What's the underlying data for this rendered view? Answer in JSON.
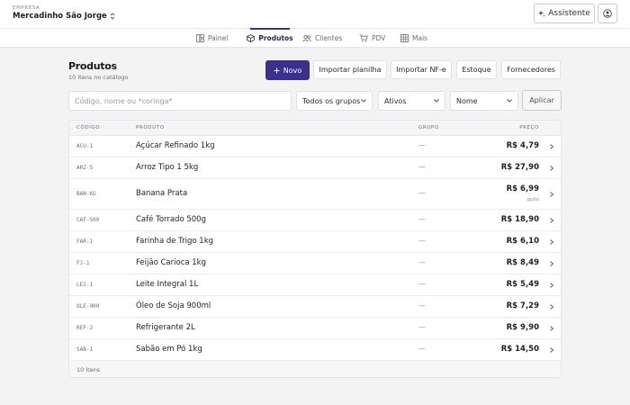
{
  "header": {
    "company_label": "EMPRESA",
    "company_name": "Mercadinho São Jorge",
    "assistant_label": "Assistente"
  },
  "tabs": [
    {
      "label": "Painel",
      "icon": "dashboard-icon",
      "active": false
    },
    {
      "label": "Produtos",
      "icon": "box-icon",
      "active": true
    },
    {
      "label": "Clientes",
      "icon": "users-icon",
      "active": false
    },
    {
      "label": "PDV",
      "icon": "cart-icon",
      "active": false
    },
    {
      "label": "Mais",
      "icon": "grid-icon",
      "active": false
    }
  ],
  "page": {
    "title": "Produtos",
    "subtitle": "10 itens no catálogo"
  },
  "actions": {
    "new": "Novo",
    "import_sheet": "Importar planilha",
    "import_nfe": "Importar NF-e",
    "stock": "Estoque",
    "suppliers": "Fornecedores"
  },
  "filters": {
    "search_placeholder": "Código, nome ou *coringa*",
    "group": "Todos os grupos",
    "status": "Ativos",
    "sort": "Nome",
    "apply": "Aplicar"
  },
  "table": {
    "columns": {
      "code": "CÓDIGO",
      "product": "PRODUTO",
      "group": "GRUPO",
      "price": "PREÇO"
    },
    "rows": [
      {
        "code": "ACU-1",
        "name": "Açúcar Refinado 1kg",
        "group": "—",
        "price": "R$ 4,79",
        "unit": ""
      },
      {
        "code": "ARZ-5",
        "name": "Arroz Tipo 1 5kg",
        "group": "—",
        "price": "R$ 27,90",
        "unit": ""
      },
      {
        "code": "BAN-KG",
        "name": "Banana Prata",
        "group": "—",
        "price": "R$ 6,99",
        "unit": "quilo"
      },
      {
        "code": "CAF-500",
        "name": "Café Torrado 500g",
        "group": "—",
        "price": "R$ 18,90",
        "unit": ""
      },
      {
        "code": "FAR-1",
        "name": "Farinha de Trigo 1kg",
        "group": "—",
        "price": "R$ 6,10",
        "unit": ""
      },
      {
        "code": "FJ-1",
        "name": "Feijão Carioca 1kg",
        "group": "—",
        "price": "R$ 8,49",
        "unit": ""
      },
      {
        "code": "LEI-1",
        "name": "Leite Integral 1L",
        "group": "—",
        "price": "R$ 5,49",
        "unit": ""
      },
      {
        "code": "OLE-900",
        "name": "Óleo de Soja 900ml",
        "group": "—",
        "price": "R$ 7,29",
        "unit": ""
      },
      {
        "code": "REF-2",
        "name": "Refrigerante 2L",
        "group": "—",
        "price": "R$ 9,90",
        "unit": ""
      },
      {
        "code": "SAB-1",
        "name": "Sabão em Pó 1kg",
        "group": "—",
        "price": "R$ 14,50",
        "unit": ""
      }
    ],
    "footer": "10 itens"
  },
  "colors": {
    "accent": "#3b2f8f",
    "background": "#f3f3f4"
  }
}
